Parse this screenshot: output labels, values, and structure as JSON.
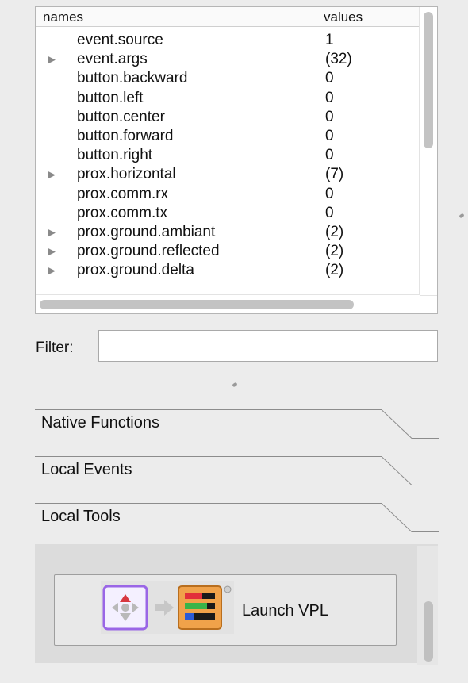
{
  "variables": {
    "header": {
      "names": "names",
      "values": "values"
    },
    "rows": [
      {
        "expand": "",
        "name": "event.source",
        "value": "1"
      },
      {
        "expand": "▶",
        "name": "event.args",
        "value": "(32)"
      },
      {
        "expand": "",
        "name": "button.backward",
        "value": "0"
      },
      {
        "expand": "",
        "name": "button.left",
        "value": "0"
      },
      {
        "expand": "",
        "name": "button.center",
        "value": "0"
      },
      {
        "expand": "",
        "name": "button.forward",
        "value": "0"
      },
      {
        "expand": "",
        "name": "button.right",
        "value": "0"
      },
      {
        "expand": "▶",
        "name": "prox.horizontal",
        "value": "(7)"
      },
      {
        "expand": "",
        "name": "prox.comm.rx",
        "value": "0"
      },
      {
        "expand": "",
        "name": "prox.comm.tx",
        "value": "0"
      },
      {
        "expand": "▶",
        "name": "prox.ground.ambiant",
        "value": "(2)"
      },
      {
        "expand": "▶",
        "name": "prox.ground.reflected",
        "value": "(2)"
      },
      {
        "expand": "▶",
        "name": "prox.ground.delta",
        "value": "(2)"
      }
    ]
  },
  "filter": {
    "label": "Filter:",
    "value": ""
  },
  "sections": {
    "native_functions": "Native Functions",
    "local_events": "Local Events",
    "local_tools": "Local Tools"
  },
  "tools": {
    "launch_vpl_label": "Launch VPL"
  },
  "icons": {
    "expand": "triangle-right-icon",
    "vpl_event": "thymio-buttons-icon",
    "vpl_arrow": "arrow-right-icon",
    "vpl_action": "thymio-colors-icon"
  }
}
